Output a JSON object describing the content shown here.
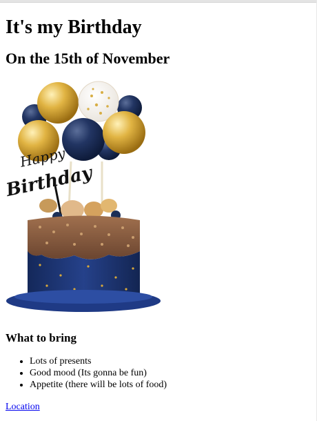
{
  "page": {
    "title": "It's my Birthday",
    "subtitle": "On the 15th of November"
  },
  "image": {
    "topper_text": "Happy Birthday",
    "icon": "birthday-cake-image"
  },
  "bring": {
    "heading": "What to bring",
    "items": [
      "Lots of presents",
      "Good mood (Its gonna be fun)",
      "Appetite (there will be lots of food)"
    ]
  },
  "link": {
    "label": "Location"
  },
  "colors": {
    "link": "#0000ee",
    "navy": "#1c2f57",
    "gold": "#d9a93a"
  }
}
